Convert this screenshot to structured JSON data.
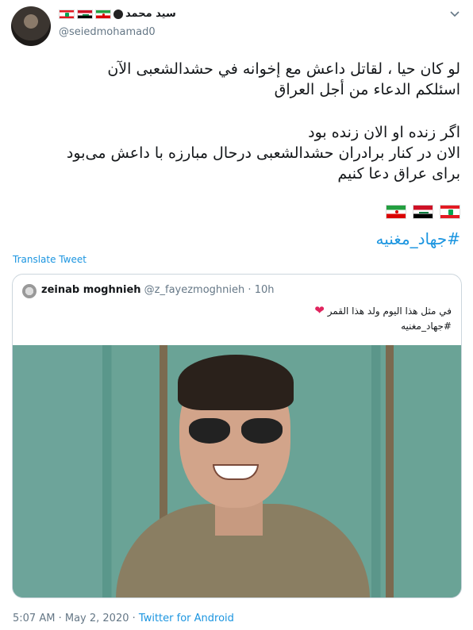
{
  "tweet": {
    "display_name": "سيد محمد",
    "handle": "@seiedmohamad0",
    "lines_ar": [
      "لو كان حيا ، لقاتل داعش مع إخوانه في حشدالشعبی الآن",
      "اسئلكم الدعاء من أجل العراق"
    ],
    "lines_fa": [
      "اگر زنده او الان زنده بود",
      "الان در کنار برادران حشدالشعبی درحال مبارزه با داعش می‌بود",
      "برای عراق دعا کنیم"
    ],
    "hashtag": "#جهاد_مغنيه",
    "translate_label": "Translate Tweet",
    "flags": [
      "lebanon-flag",
      "iraq-flag",
      "iran-flag"
    ]
  },
  "quoted": {
    "name": "zeinab moghnieh",
    "handle": "@z_fayezmoghnieh",
    "separator": "·",
    "time": "10h",
    "line1": "في مثل هذا اليوم ولد هذا القمر",
    "line2": "#جهاد_مغنيه"
  },
  "footer": {
    "time": "5:07 AM",
    "separator": "·",
    "date": "May 2, 2020",
    "source": "Twitter for Android"
  },
  "colors": {
    "link": "#1b95e0",
    "muted": "#657786",
    "heart": "#e0245e"
  }
}
